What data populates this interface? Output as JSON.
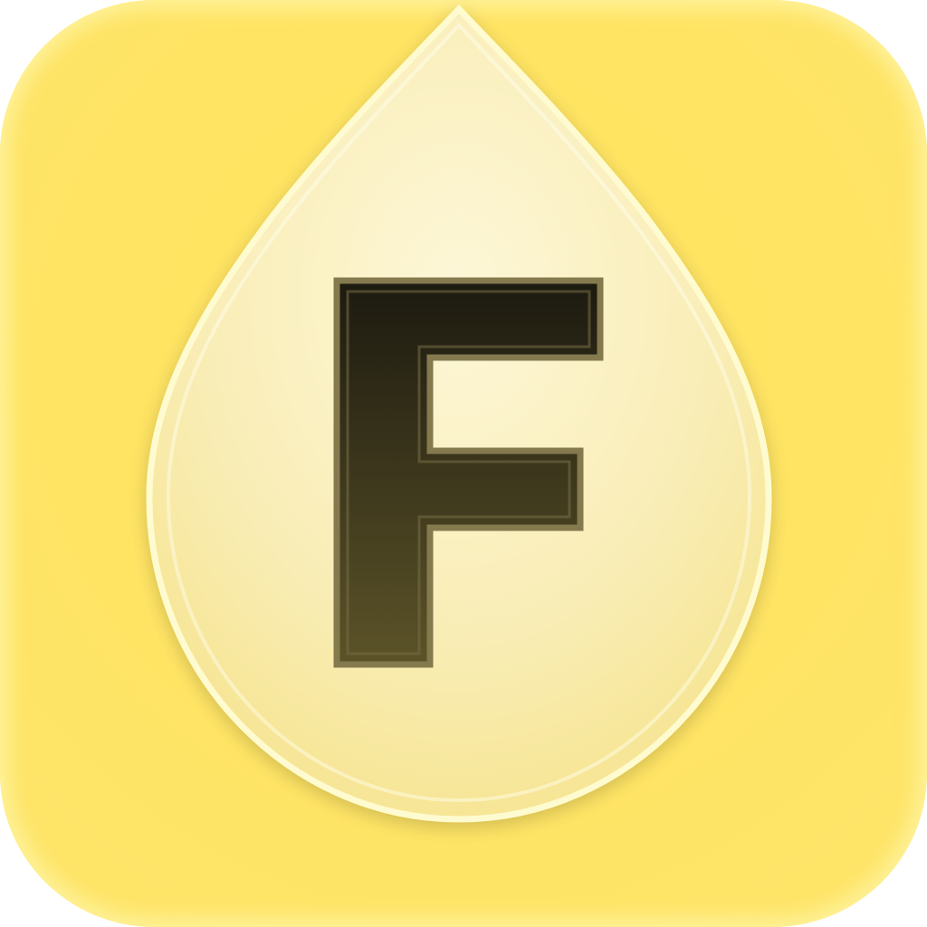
{
  "app_icon": {
    "letter": "F",
    "icon_name": "droplet-letter-f-icon",
    "colors": {
      "tile": "#ffe35e",
      "tile_rim": "#fff3a8",
      "drop_top": "#fdf7d7",
      "drop_bottom": "#f8e79a",
      "drop_edge": "#fffbd0",
      "letter_top": "#1c1a10",
      "letter_bottom": "#5c5328",
      "letter_bevel": "#847a4e"
    }
  }
}
